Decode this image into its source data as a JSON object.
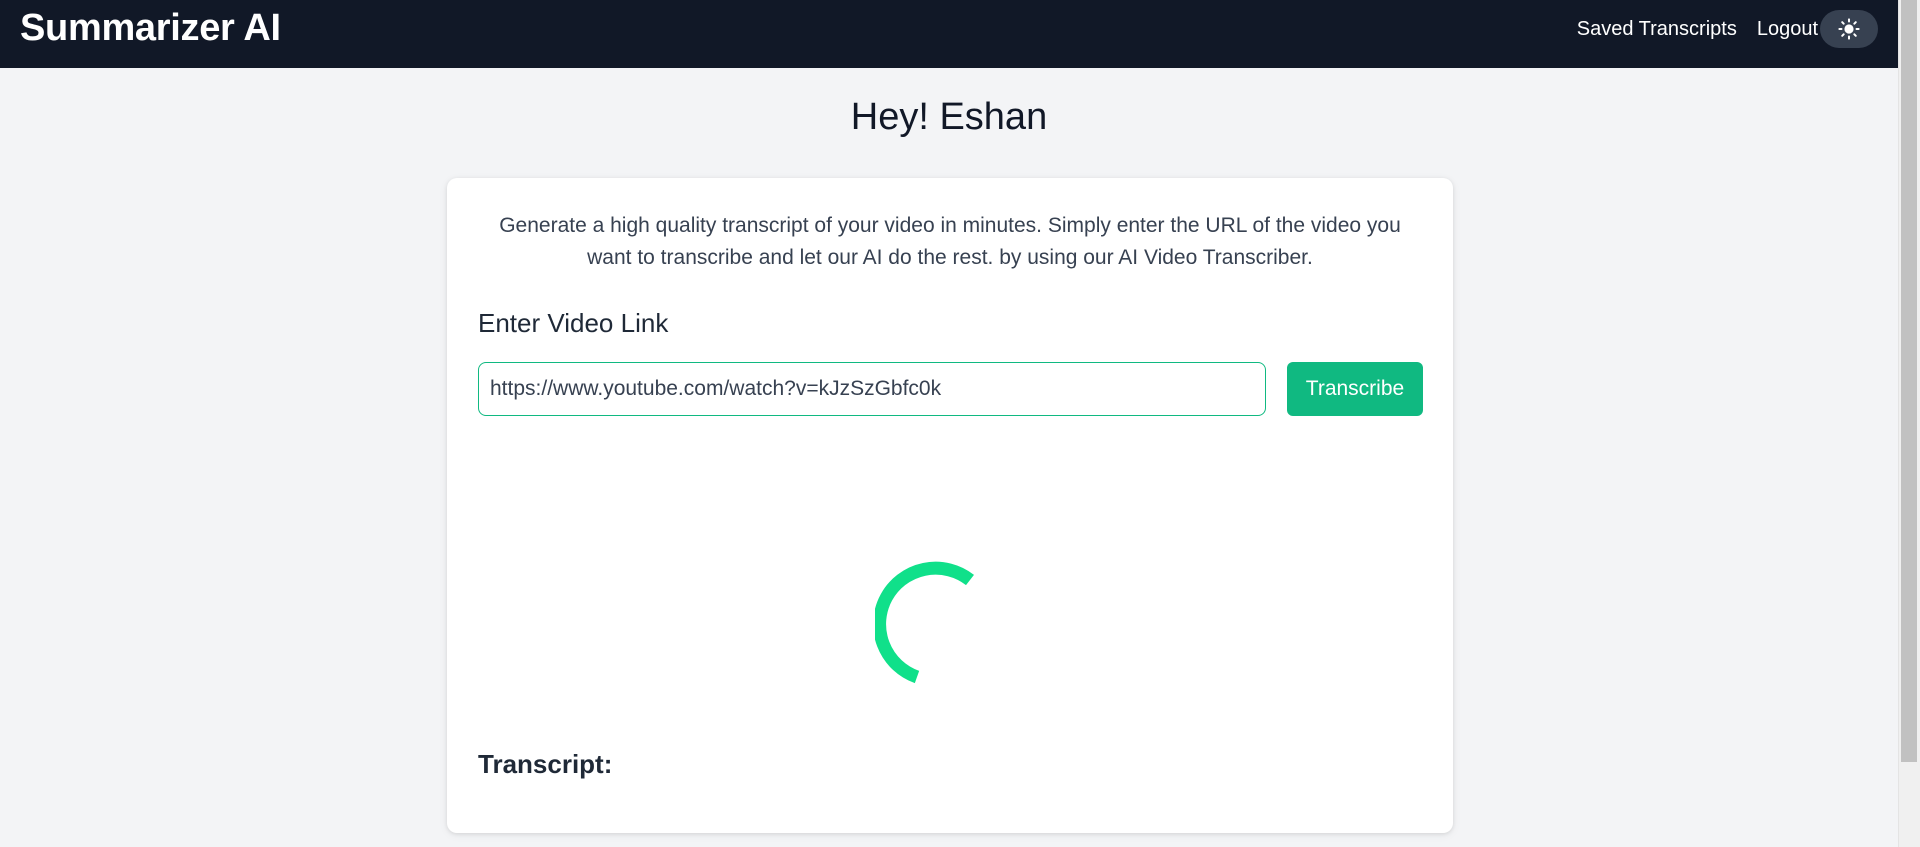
{
  "header": {
    "title": "Summarizer AI",
    "nav": {
      "saved_transcripts": "Saved Transcripts",
      "logout": "Logout"
    },
    "theme_toggle_icon": "sun-icon"
  },
  "main": {
    "greeting": "Hey! Eshan",
    "description": "Generate a high quality transcript of your video in minutes. Simply enter the URL of the video you want to transcribe and let our AI do the rest. by using our AI Video Transcriber.",
    "link_heading": "Enter Video Link",
    "url_input": {
      "value": "https://www.youtube.com/watch?v=kJzSzGbfc0k"
    },
    "transcribe_button": "Transcribe",
    "loading_icon": "spinner-icon",
    "transcript_label": "Transcript:"
  },
  "colors": {
    "nav_background": "#111827",
    "accent": "#10b981",
    "spinner": "#10e08a",
    "page_background": "#f3f4f6"
  }
}
